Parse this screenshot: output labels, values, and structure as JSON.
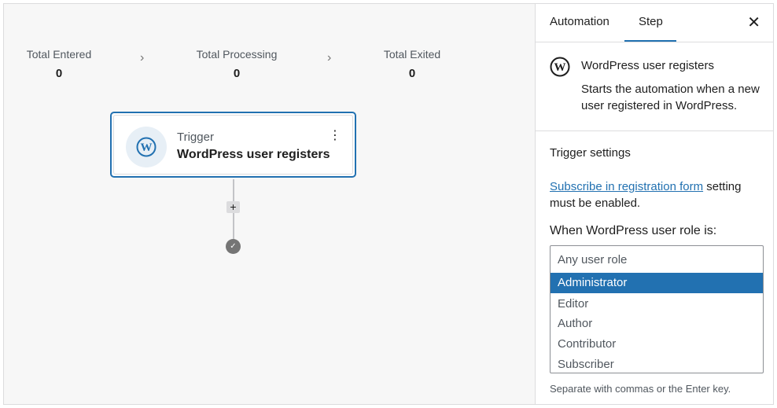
{
  "stats": [
    {
      "label": "Total Entered",
      "value": "0"
    },
    {
      "label": "Total Processing",
      "value": "0"
    },
    {
      "label": "Total Exited",
      "value": "0"
    }
  ],
  "chevron": "›",
  "trigger_card": {
    "kind": "Trigger",
    "name": "WordPress user registers",
    "menu_glyph": "⋮"
  },
  "flow": {
    "add_glyph": "+",
    "end_glyph": "✓"
  },
  "panel": {
    "tabs": [
      {
        "label": "Automation"
      },
      {
        "label": "Step"
      }
    ],
    "active_tab": "Step",
    "close_glyph": "✕",
    "step_title": "WordPress user registers",
    "step_description": "Starts the automation when a new user registered in WordPress.",
    "settings_heading": "Trigger settings",
    "note_link": "Subscribe in registration form",
    "note_text": " setting must be enabled.",
    "role_label": "When WordPress user role is:",
    "role_placeholder": "Any user role",
    "role_options": [
      "Administrator",
      "Editor",
      "Author",
      "Contributor",
      "Subscriber"
    ],
    "role_highlighted": "Administrator",
    "help_text": "Separate with commas or the Enter key."
  },
  "colors": {
    "accent": "#2271b1",
    "canvas": "#f7f7f7",
    "border": "#dcdcde"
  },
  "icons": [
    "wordpress-icon",
    "chevron-right-icon",
    "more-vertical-icon",
    "plus-icon",
    "check-icon",
    "close-icon"
  ]
}
